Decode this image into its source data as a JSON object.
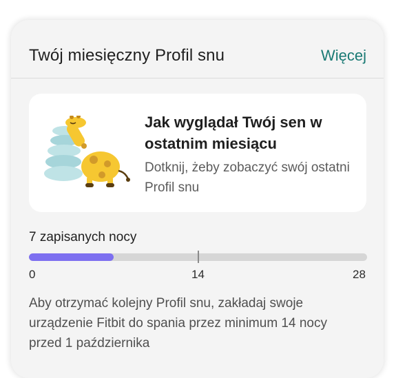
{
  "header": {
    "title": "Twój miesięczny Profil snu",
    "more_label": "Więcej"
  },
  "promo": {
    "illustration_icon": "giraffe-sleeping-on-pillows-icon",
    "heading": "Jak wyglądał Twój sen w ostatnim miesiącu",
    "subtext": "Dotknij, żeby zobaczyć swój ostatni Profil snu"
  },
  "progress": {
    "label": "7 zapisanych nocy",
    "value": 7,
    "min": 0,
    "threshold": 14,
    "max": 28,
    "tick_start": "0",
    "tick_mid": "14",
    "tick_end": "28",
    "fill_color": "#7d6ff0",
    "track_color": "#d6d6d6"
  },
  "info": {
    "text": "Aby otrzymać kolejny Profil snu, zakładaj swoje urządzenie Fitbit do spania przez minimum 14 nocy przed 1 października"
  },
  "colors": {
    "accent": "#1a7a74",
    "card_bg": "#f4f4f4"
  }
}
